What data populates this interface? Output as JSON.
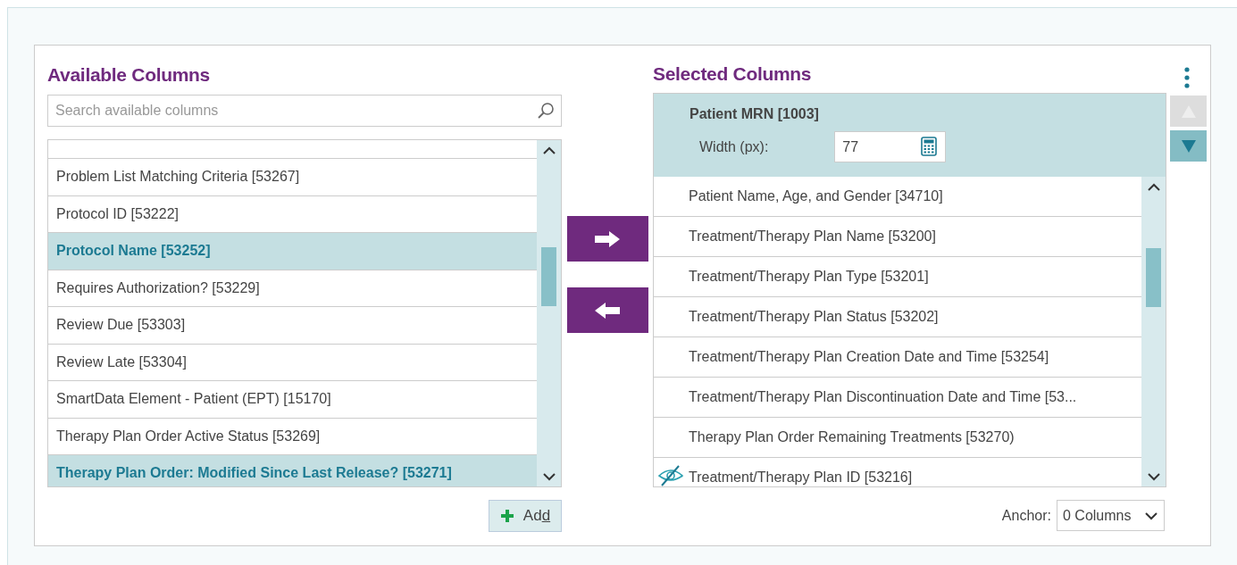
{
  "available": {
    "title": "Available Columns",
    "search": {
      "placeholder": "Search available columns"
    },
    "items": [
      {
        "label": "Problem List Matching Criteria [53267]",
        "selected": false
      },
      {
        "label": "Protocol ID [53222]",
        "selected": false
      },
      {
        "label": "Protocol Name [53252]",
        "selected": true
      },
      {
        "label": "Requires Authorization? [53229]",
        "selected": false
      },
      {
        "label": "Review Due [53303]",
        "selected": false
      },
      {
        "label": "Review Late [53304]",
        "selected": false
      },
      {
        "label": "SmartData Element - Patient (EPT) [15170]",
        "selected": false
      },
      {
        "label": "Therapy Plan Order Active Status [53269]",
        "selected": false
      },
      {
        "label": "Therapy Plan Order: Modified Since Last Release? [53271]",
        "selected": true
      }
    ],
    "add_button": "Add"
  },
  "selected": {
    "title": "Selected Columns",
    "current": {
      "label": "Patient MRN [1003]",
      "width_label": "Width (px):",
      "width_value": "77"
    },
    "items": [
      {
        "label": "Patient Name, Age, and Gender [34710]",
        "hidden": false
      },
      {
        "label": "Treatment/Therapy Plan Name [53200]",
        "hidden": false
      },
      {
        "label": "Treatment/Therapy Plan Type [53201]",
        "hidden": false
      },
      {
        "label": "Treatment/Therapy Plan Status [53202]",
        "hidden": false
      },
      {
        "label": "Treatment/Therapy Plan Creation Date and Time [53254]",
        "hidden": false
      },
      {
        "label": "Treatment/Therapy Plan Discontinuation Date and Time [53...",
        "hidden": false
      },
      {
        "label": "Therapy Plan Order Remaining Treatments [53270)",
        "hidden": false
      },
      {
        "label": "Treatment/Therapy Plan ID [53216]",
        "hidden": true
      }
    ],
    "move_up_disabled": true,
    "move_down_disabled": false,
    "anchor_label": "Anchor:",
    "anchor_value": "0 Columns"
  }
}
